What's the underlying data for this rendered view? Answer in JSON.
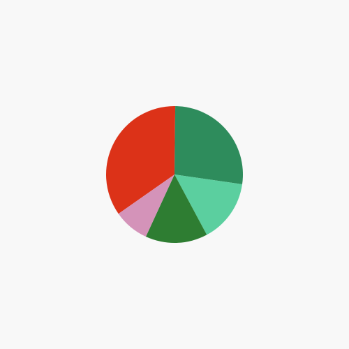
{
  "chart_data": {
    "type": "pie",
    "title": "",
    "categories": [
      "",
      "",
      "",
      "",
      ""
    ],
    "values": [
      34.9,
      27.1,
      14.9,
      14.7,
      8.4
    ],
    "colors": [
      "#dc3218",
      "#2e8c5c",
      "#5bcf9f",
      "#2e7d32",
      "#d493b9"
    ],
    "start_angle_deg": -125,
    "direction": "clockwise",
    "legend": "none"
  }
}
